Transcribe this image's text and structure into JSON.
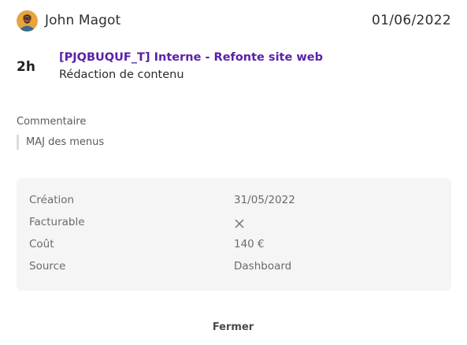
{
  "header": {
    "user_name": "John Magot",
    "date": "01/06/2022",
    "avatar_icon": "user-avatar-photo"
  },
  "entry": {
    "duration": "2h",
    "project": "[PJQBUQUF_T] Interne - Refonte site web",
    "task": "Rédaction de contenu"
  },
  "comment": {
    "label": "Commentaire",
    "text": "MAJ des menus"
  },
  "details": {
    "rows": [
      {
        "key": "Création",
        "value": "31/05/2022"
      },
      {
        "key": "Facturable",
        "value": "",
        "icon": "close-icon"
      },
      {
        "key": "Coût",
        "value": "140 €"
      },
      {
        "key": "Source",
        "value": "Dashboard"
      }
    ]
  },
  "footer": {
    "close_label": "Fermer"
  },
  "colors": {
    "accent": "#5b21a8",
    "panel_bg": "#f5f5f5"
  }
}
